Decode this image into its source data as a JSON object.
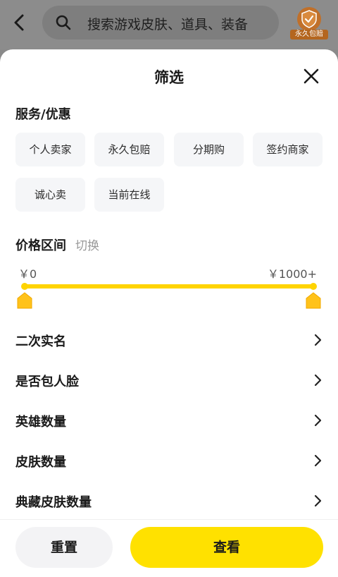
{
  "search": {
    "placeholder": "搜索游戏皮肤、道具、装备"
  },
  "badge": {
    "label": "永久包赔"
  },
  "sheet": {
    "title": "筛选",
    "service_title": "服务/优惠",
    "chips": [
      "个人卖家",
      "永久包赔",
      "分期购",
      "签约商家",
      "诚心卖",
      "当前在线"
    ],
    "price_title": "价格区间",
    "price_switch": "切换",
    "price_min": "￥0",
    "price_max": "￥1000+",
    "price_range": {
      "low_fraction": 0,
      "high_fraction": 1
    },
    "rows": [
      "二次实名",
      "是否包人脸",
      "英雄数量",
      "皮肤数量",
      "典藏皮肤数量"
    ]
  },
  "footer": {
    "reset": "重置",
    "view": "查看"
  },
  "colors": {
    "accent": "#ffe100",
    "track": "#ffd400",
    "chip_bg": "#f5f6f8"
  }
}
